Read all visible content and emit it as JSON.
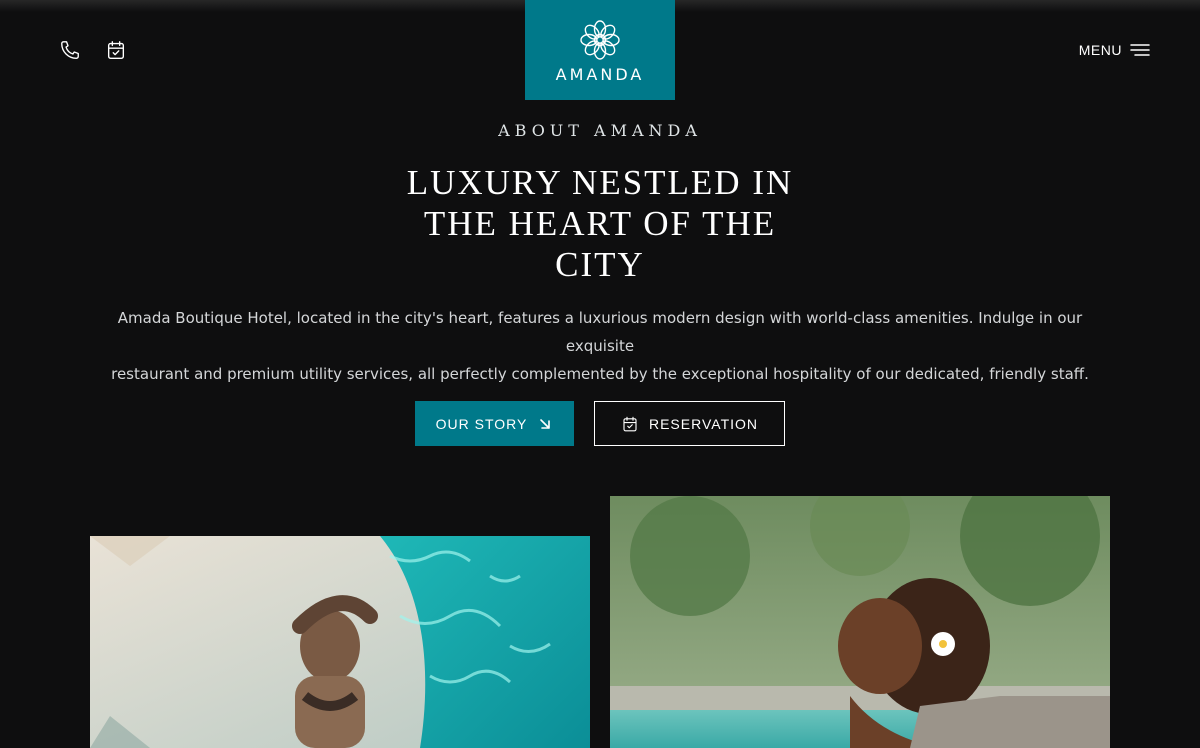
{
  "header": {
    "phone_icon": "phone-icon",
    "calendar_icon": "calendar-check-icon",
    "logo_text": "AMANDA",
    "logo_icon": "flower-emblem-icon",
    "menu_label": "MENU",
    "menu_icon": "hamburger-icon"
  },
  "about": {
    "eyebrow": "ABOUT AMANDA",
    "headline_lines": [
      "LUXURY NESTLED IN",
      "THE HEART OF THE",
      "CITY"
    ],
    "description_lines": [
      "Amada Boutique Hotel, located in the city's heart, features a luxurious modern design with world-class amenities. Indulge in our exquisite",
      "restaurant and premium utility services, all perfectly complemented by the exceptional hospitality of our dedicated, friendly staff."
    ]
  },
  "buttons": {
    "story_label": "OUR STORY",
    "story_icon": "arrow-down-right-icon",
    "reservation_label": "RESERVATION",
    "reservation_icon": "calendar-check-icon"
  },
  "colors": {
    "brand_teal": "#00798a",
    "background": "#0e0e0f",
    "text": "#ffffff",
    "muted_text": "#d4d6d8"
  }
}
